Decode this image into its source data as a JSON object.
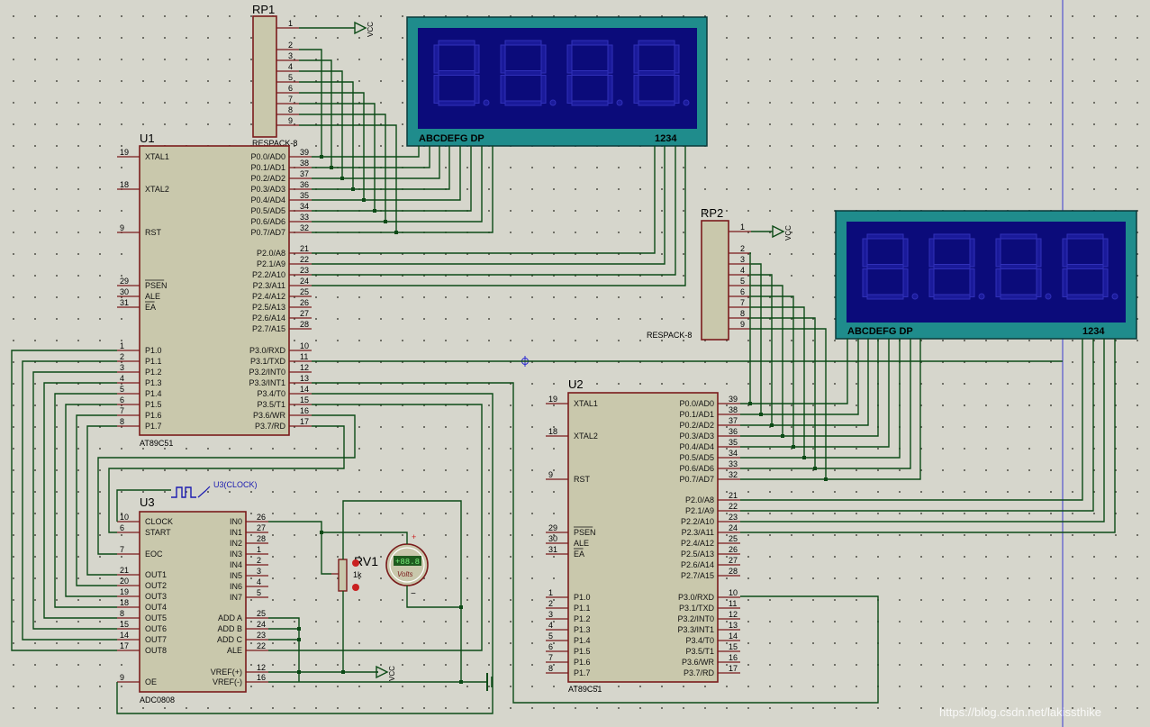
{
  "schematic": {
    "u1": {
      "ref": "U1",
      "part": "AT89C51",
      "left_pins": [
        {
          "num": "19",
          "name": "XTAL1"
        },
        {
          "num": "18",
          "name": "XTAL2"
        },
        {
          "num": "9",
          "name": "RST"
        },
        {
          "num": "29",
          "name": "PSEN"
        },
        {
          "num": "30",
          "name": "ALE"
        },
        {
          "num": "31",
          "name": "EA"
        },
        {
          "num": "1",
          "name": "P1.0"
        },
        {
          "num": "2",
          "name": "P1.1"
        },
        {
          "num": "3",
          "name": "P1.2"
        },
        {
          "num": "4",
          "name": "P1.3"
        },
        {
          "num": "5",
          "name": "P1.4"
        },
        {
          "num": "6",
          "name": "P1.5"
        },
        {
          "num": "7",
          "name": "P1.6"
        },
        {
          "num": "8",
          "name": "P1.7"
        }
      ],
      "right_pins": [
        {
          "num": "39",
          "name": "P0.0/AD0"
        },
        {
          "num": "38",
          "name": "P0.1/AD1"
        },
        {
          "num": "37",
          "name": "P0.2/AD2"
        },
        {
          "num": "36",
          "name": "P0.3/AD3"
        },
        {
          "num": "35",
          "name": "P0.4/AD4"
        },
        {
          "num": "34",
          "name": "P0.5/AD5"
        },
        {
          "num": "33",
          "name": "P0.6/AD6"
        },
        {
          "num": "32",
          "name": "P0.7/AD7"
        },
        {
          "num": "21",
          "name": "P2.0/A8"
        },
        {
          "num": "22",
          "name": "P2.1/A9"
        },
        {
          "num": "23",
          "name": "P2.2/A10"
        },
        {
          "num": "24",
          "name": "P2.3/A11"
        },
        {
          "num": "25",
          "name": "P2.4/A12"
        },
        {
          "num": "26",
          "name": "P2.5/A13"
        },
        {
          "num": "27",
          "name": "P2.6/A14"
        },
        {
          "num": "28",
          "name": "P2.7/A15"
        },
        {
          "num": "10",
          "name": "P3.0/RXD"
        },
        {
          "num": "11",
          "name": "P3.1/TXD"
        },
        {
          "num": "12",
          "name": "P3.2/INT0"
        },
        {
          "num": "13",
          "name": "P3.3/INT1"
        },
        {
          "num": "14",
          "name": "P3.4/T0"
        },
        {
          "num": "15",
          "name": "P3.5/T1"
        },
        {
          "num": "16",
          "name": "P3.6/WR"
        },
        {
          "num": "17",
          "name": "P3.7/RD"
        }
      ]
    },
    "u2": {
      "ref": "U2",
      "part": "AT89C51"
    },
    "u3": {
      "ref": "U3",
      "part": "ADC0808",
      "clock_label": "U3(CLOCK)",
      "left_pins": [
        {
          "num": "10",
          "name": "CLOCK"
        },
        {
          "num": "6",
          "name": "START"
        },
        {
          "num": "7",
          "name": "EOC"
        },
        {
          "num": "21",
          "name": "OUT1"
        },
        {
          "num": "20",
          "name": "OUT2"
        },
        {
          "num": "19",
          "name": "OUT3"
        },
        {
          "num": "18",
          "name": "OUT4"
        },
        {
          "num": "8",
          "name": "OUT5"
        },
        {
          "num": "15",
          "name": "OUT6"
        },
        {
          "num": "14",
          "name": "OUT7"
        },
        {
          "num": "17",
          "name": "OUT8"
        },
        {
          "num": "9",
          "name": "OE"
        }
      ],
      "right_pins": [
        {
          "num": "26",
          "name": "IN0"
        },
        {
          "num": "27",
          "name": "IN1"
        },
        {
          "num": "28",
          "name": "IN2"
        },
        {
          "num": "1",
          "name": "IN3"
        },
        {
          "num": "2",
          "name": "IN4"
        },
        {
          "num": "3",
          "name": "IN5"
        },
        {
          "num": "4",
          "name": "IN6"
        },
        {
          "num": "5",
          "name": "IN7"
        },
        {
          "num": "25",
          "name": "ADD A"
        },
        {
          "num": "24",
          "name": "ADD B"
        },
        {
          "num": "23",
          "name": "ADD C"
        },
        {
          "num": "22",
          "name": "ALE"
        },
        {
          "num": "12",
          "name": "VREF(+)"
        },
        {
          "num": "16",
          "name": "VREF(-)"
        }
      ]
    },
    "rp1": {
      "ref": "RP1",
      "part": "RESPACK-8",
      "pins": [
        "1",
        "2",
        "3",
        "4",
        "5",
        "6",
        "7",
        "8",
        "9"
      ]
    },
    "rp2": {
      "ref": "RP2",
      "part": "RESPACK-8",
      "pins": [
        "1",
        "2",
        "3",
        "4",
        "5",
        "6",
        "7",
        "8",
        "9"
      ]
    },
    "rv1": {
      "ref": "RV1",
      "value": "1k"
    },
    "vcc_label": "VCC",
    "display1": {
      "seg_label": "ABCDEFG  DP",
      "digit_label": "1234"
    },
    "display2": {
      "seg_label": "ABCDEFG  DP",
      "digit_label": "1234"
    },
    "voltmeter": {
      "reading": "+88.8",
      "unit": "Volts",
      "plus": "+",
      "minus": "−"
    },
    "watermark": "https://blog.csdn.net/lakissthike"
  },
  "colors": {
    "background": "#d6d6cc",
    "chip_fill": "#c9c8ac",
    "chip_border": "#7a1b1b",
    "wire": "#0c4a16",
    "display_frame": "#1f8c8c",
    "display_screen": "#0b0b7a",
    "vertical_guide": "#3a3ad0"
  }
}
